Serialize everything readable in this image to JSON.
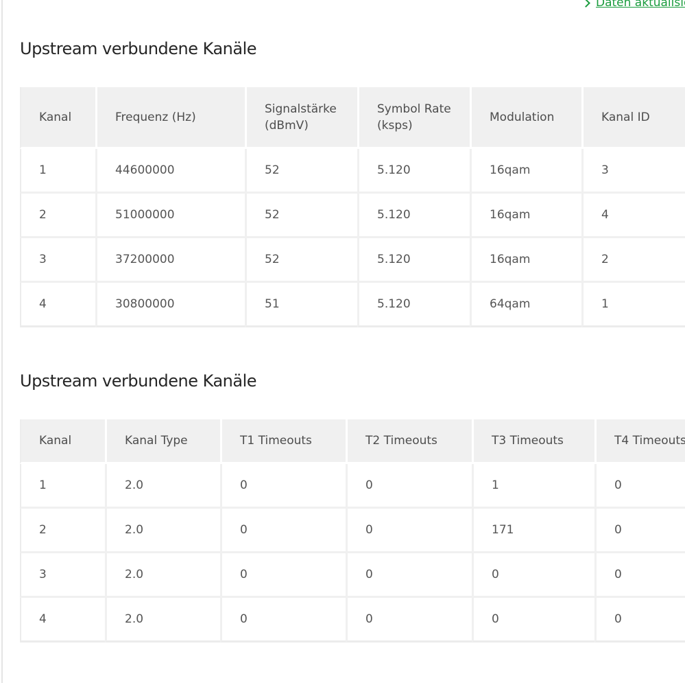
{
  "header": {
    "refresh_link": "Daten aktualisieren"
  },
  "upstream_table": {
    "title": "Upstream verbundene Kanäle",
    "columns": [
      "Kanal",
      "Frequenz (Hz)",
      "Signalstärke (dBmV)",
      "Symbol Rate (ksps)",
      "Modulation",
      "Kanal ID"
    ],
    "rows": [
      [
        "1",
        "44600000",
        "52",
        "5.120",
        "16qam",
        "3"
      ],
      [
        "2",
        "51000000",
        "52",
        "5.120",
        "16qam",
        "4"
      ],
      [
        "3",
        "37200000",
        "52",
        "5.120",
        "16qam",
        "2"
      ],
      [
        "4",
        "30800000",
        "51",
        "5.120",
        "64qam",
        "1"
      ]
    ]
  },
  "timeouts_table": {
    "title": "Upstream verbundene Kanäle",
    "columns": [
      "Kanal",
      "Kanal Type",
      "T1 Timeouts",
      "T2 Timeouts",
      "T3 Timeouts",
      "T4 Timeouts"
    ],
    "rows": [
      [
        "1",
        "2.0",
        "0",
        "0",
        "1",
        "0"
      ],
      [
        "2",
        "2.0",
        "0",
        "0",
        "171",
        "0"
      ],
      [
        "3",
        "2.0",
        "0",
        "0",
        "0",
        "0"
      ],
      [
        "4",
        "2.0",
        "0",
        "0",
        "0",
        "0"
      ]
    ]
  },
  "colors": {
    "link": "#1a9c3e",
    "header_bg": "#f0f0f0",
    "text": "#555555",
    "title": "#262626"
  }
}
